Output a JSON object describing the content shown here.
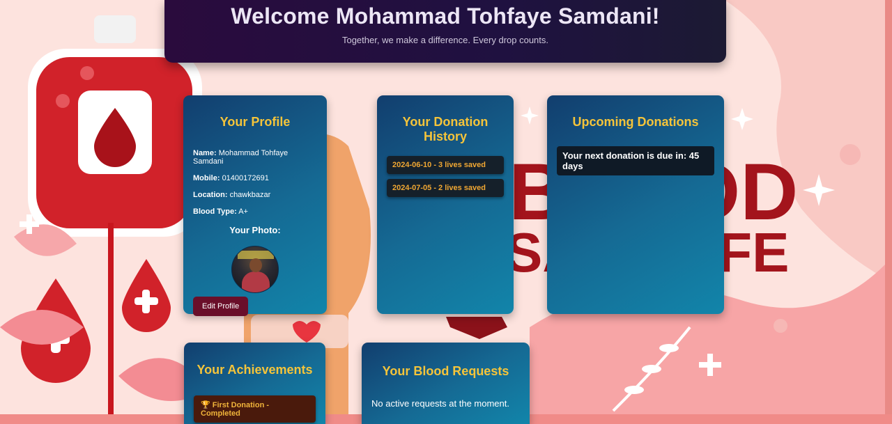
{
  "header": {
    "title": "Welcome Mohammad Tohfaye Samdani!",
    "subtitle": "Together, we make a difference. Every drop counts."
  },
  "profile": {
    "title": "Your Profile",
    "name_label": "Name:",
    "name": "Mohammad Tohfaye Samdani",
    "mobile_label": "Mobile:",
    "mobile": "01400172691",
    "location_label": "Location:",
    "location": "chawkbazar",
    "blood_type_label": "Blood Type:",
    "blood_type": "A+",
    "photo_title": "Your Photo:",
    "edit_label": "Edit Profile"
  },
  "history": {
    "title": "Your Donation History",
    "items": [
      "2024-06-10 - 3 lives saved",
      "2024-07-05 - 2 lives saved"
    ]
  },
  "upcoming": {
    "title": "Upcoming Donations",
    "next_due": "Your next donation is due in: 45 days"
  },
  "achievements": {
    "title": "Your Achievements",
    "items": [
      "🏆 First Donation - Completed"
    ]
  },
  "requests": {
    "title": "Your Blood Requests",
    "empty_text": "No active requests at the moment."
  },
  "background": {
    "poster_text_line1": "BLOOD",
    "poster_text_line2": "SAVE LIFE"
  },
  "colors": {
    "accent_gold": "#f5c43a",
    "history_text": "#f0a733",
    "card_gradient_start": "#123e6e",
    "card_gradient_end": "#1285aa",
    "header_bg": "#2a0b3d",
    "edit_button_bg": "#6a0f2a"
  }
}
